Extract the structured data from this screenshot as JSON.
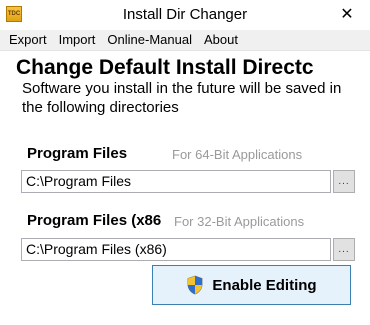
{
  "window": {
    "icon_text": "TDC",
    "title": "Install Dir Changer",
    "close_glyph": "✕"
  },
  "menu": {
    "items": [
      "Export",
      "Import",
      "Online-Manual",
      "About"
    ]
  },
  "main": {
    "heading": "Change Default Install Directc",
    "subtitle": "Software you install in the future will be saved in the following directories"
  },
  "program_files": {
    "label": "Program Files",
    "hint": "For 64-Bit Applications",
    "value": "C:\\Program Files",
    "browse_label": "..."
  },
  "program_files_x86": {
    "label": "Program Files (x86",
    "hint": "For 32-Bit Applications",
    "value": "C:\\Program Files (x86)",
    "browse_label": "..."
  },
  "actions": {
    "enable_editing_label": "Enable Editing",
    "shield_icon": "uac-shield-icon"
  },
  "colors": {
    "button_border": "#3c7fb1",
    "button_bg": "#e5f1fb",
    "hint_text": "#9a9a9a"
  }
}
